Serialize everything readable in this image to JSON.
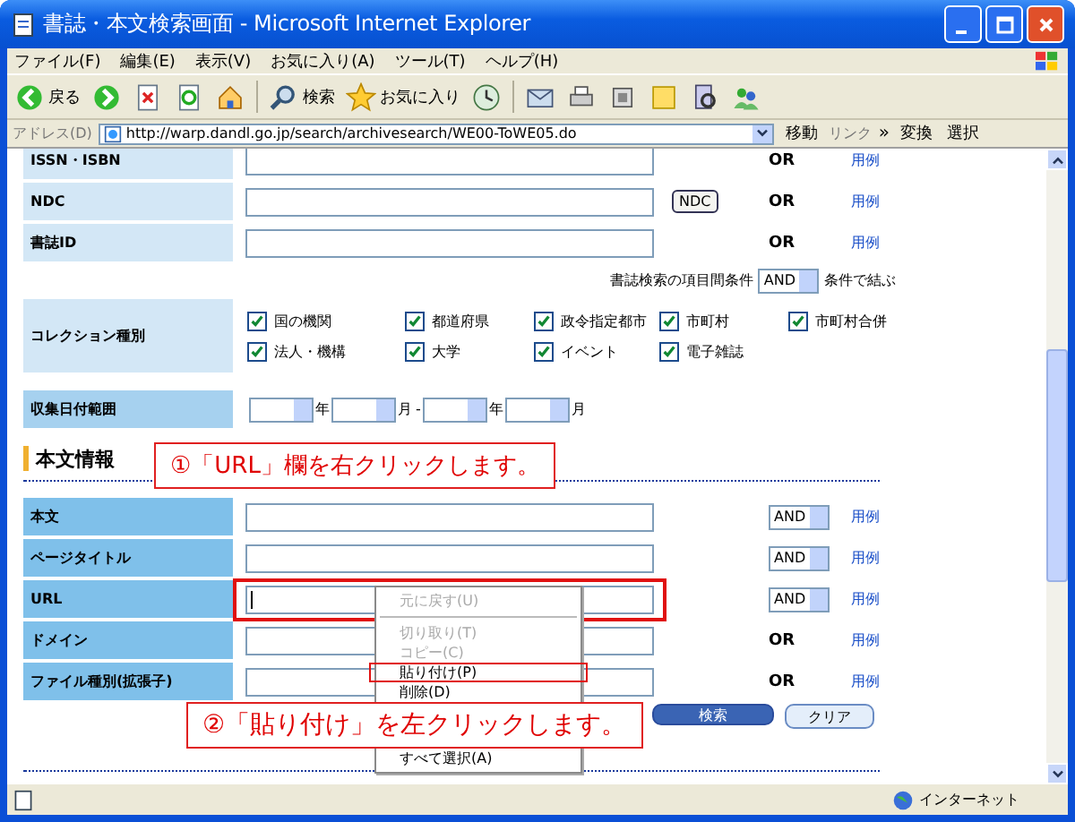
{
  "window": {
    "title": "書誌・本文検索画面 - Microsoft Internet Explorer"
  },
  "menu": [
    "ファイル(F)",
    "編集(E)",
    "表示(V)",
    "お気に入り(A)",
    "ツール(T)",
    "ヘルプ(H)"
  ],
  "toolbar": [
    {
      "kind": "back",
      "label": "戻る"
    },
    {
      "kind": "forward"
    },
    {
      "kind": "stop"
    },
    {
      "kind": "refresh"
    },
    {
      "kind": "home"
    },
    {
      "kind": "search",
      "label": "検索"
    },
    {
      "kind": "favorites",
      "label": "お気に入り"
    },
    {
      "kind": "history"
    },
    {
      "kind": "mail"
    },
    {
      "kind": "print"
    },
    {
      "kind": "edit"
    },
    {
      "kind": "note"
    },
    {
      "kind": "research"
    },
    {
      "kind": "messenger"
    }
  ],
  "address": {
    "label": "アドレス(D)",
    "url": "http://warp.dandl.go.jp/search/archivesearch/WE00-ToWE05.do",
    "go": "移動",
    "links": "リンク",
    "chevron": "»",
    "translate": "変換",
    "select": "選択"
  },
  "biblio_rows": [
    {
      "label": "ISSN・ISBN",
      "connector": "OR",
      "example": "用例"
    },
    {
      "label": "NDC",
      "button": "NDC",
      "connector": "OR",
      "example": "用例"
    },
    {
      "label": "書誌ID",
      "connector": "OR",
      "example": "用例"
    }
  ],
  "condition": {
    "prefix": "書誌検索の項目間条件",
    "value": "AND",
    "suffix": "条件で結ぶ"
  },
  "collection": {
    "label": "コレクション種別",
    "options": [
      {
        "label": "国の機関",
        "checked": true
      },
      {
        "label": "都道府県",
        "checked": true
      },
      {
        "label": "政令指定都市",
        "checked": true
      },
      {
        "label": "市町村",
        "checked": true
      },
      {
        "label": "市町村合併",
        "checked": true
      },
      {
        "label": "法人・機構",
        "checked": true
      },
      {
        "label": "大学",
        "checked": true
      },
      {
        "label": "イベント",
        "checked": true
      },
      {
        "label": "電子雑誌",
        "checked": true
      }
    ]
  },
  "date_range": {
    "label": "収集日付範囲",
    "from": {
      "year": "年",
      "month": "月"
    },
    "separator": "-",
    "to": {
      "year": "年",
      "month": "月"
    }
  },
  "section": {
    "title": "本文情報"
  },
  "text_rows": [
    {
      "label": "本文",
      "kind": "select",
      "operator": "AND",
      "example": "用例",
      "focused": false,
      "highlighted": false
    },
    {
      "label": "ページタイトル",
      "kind": "select",
      "operator": "AND",
      "example": "用例",
      "focused": false,
      "highlighted": false
    },
    {
      "label": "URL",
      "kind": "select",
      "operator": "AND",
      "example": "用例",
      "focused": true,
      "highlighted": true
    },
    {
      "label": "ドメイン",
      "kind": "fixed",
      "operator": "OR",
      "example": "用例",
      "focused": false,
      "highlighted": false
    },
    {
      "label": "ファイル種別(拡張子)",
      "kind": "fixed",
      "operator": "OR",
      "example": "用例",
      "focused": false,
      "highlighted": false
    }
  ],
  "buttons": [
    {
      "label": "検索",
      "kind": "primary"
    },
    {
      "label": "クリア",
      "kind": "secondary"
    }
  ],
  "context_menu": {
    "items": [
      {
        "kind": "item",
        "label": "元に戻す(U)",
        "disabled": true,
        "highlighted": false
      },
      {
        "kind": "separator"
      },
      {
        "kind": "item",
        "label": "切り取り(T)",
        "disabled": true,
        "highlighted": false
      },
      {
        "kind": "item",
        "label": "コピー(C)",
        "disabled": true,
        "highlighted": false
      },
      {
        "kind": "item",
        "label": "貼り付け(P)",
        "disabled": false,
        "highlighted": true
      },
      {
        "kind": "item",
        "label": "削除(D)",
        "disabled": false,
        "highlighted": false
      },
      {
        "kind": "gap"
      },
      {
        "kind": "item",
        "label": "すべて選択(A)",
        "disabled": false,
        "highlighted": false
      }
    ]
  },
  "callouts": [
    {
      "text": "①「URL」欄を右クリックします。",
      "kind": "field"
    },
    {
      "text": "②「貼り付け」を左クリックします。",
      "kind": "menu"
    }
  ],
  "status_bar": {
    "zone": "インターネット"
  }
}
